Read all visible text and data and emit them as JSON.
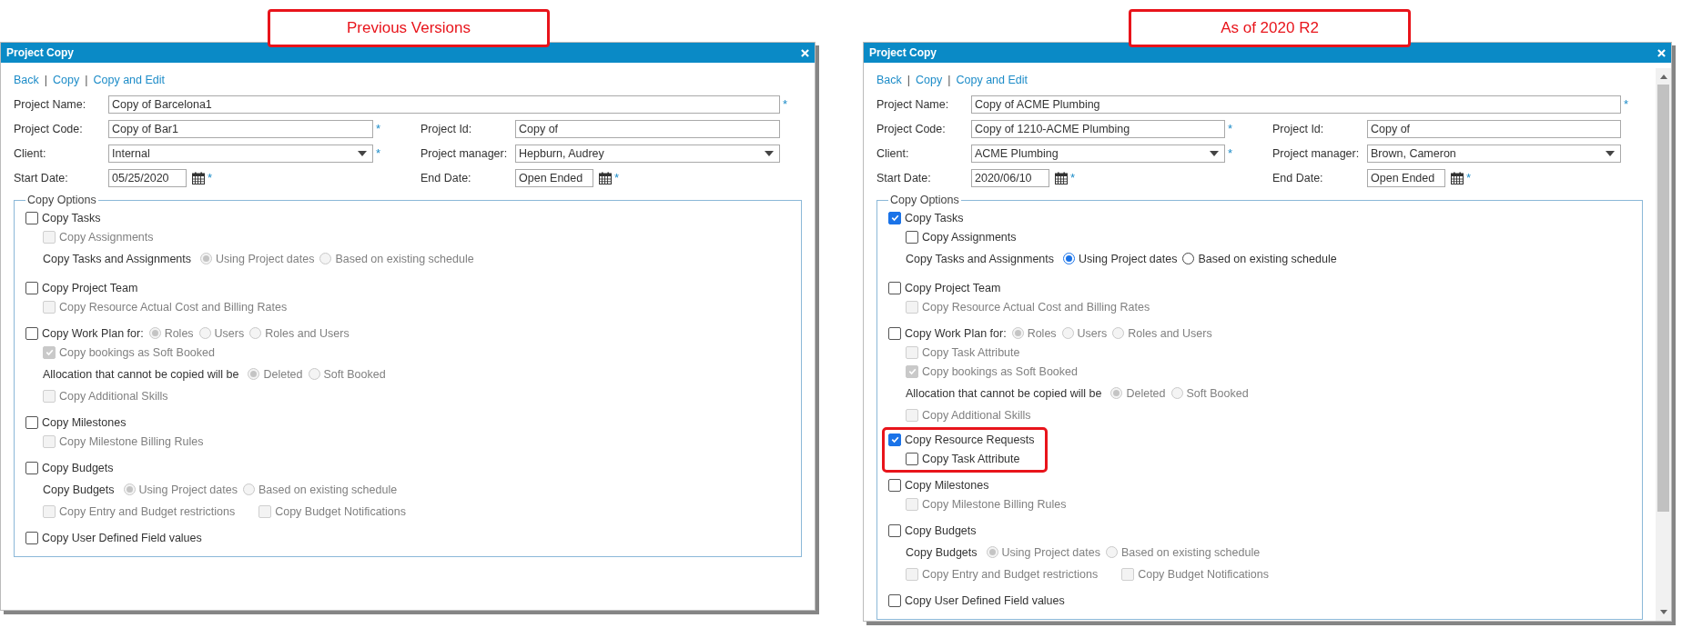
{
  "panels": [
    {
      "caption": "Previous Versions",
      "window_title": "Project Copy",
      "toolbar": [
        {
          "kind": "link",
          "text": "Back"
        },
        {
          "kind": "separator",
          "text": "|"
        },
        {
          "kind": "link",
          "text": "Copy"
        },
        {
          "kind": "separator",
          "text": "|"
        },
        {
          "kind": "link",
          "text": "Copy and Edit"
        }
      ],
      "field_rows": [
        [
          {
            "label": "Project Name:",
            "kind": "text",
            "value": "Copy of Barcelona1",
            "required_mark": "*"
          }
        ],
        [
          {
            "label": "Project Code:",
            "kind": "text",
            "value": "Copy of Bar1",
            "required_mark": "*"
          },
          {
            "label": "Project Id:",
            "kind": "text",
            "value": "Copy of"
          }
        ],
        [
          {
            "label": "Client:",
            "kind": "select",
            "value": "Internal",
            "required_mark": "*"
          },
          {
            "label": "Project manager:",
            "kind": "select",
            "value": "Hepburn, Audrey"
          }
        ],
        [
          {
            "label": "Start Date:",
            "kind": "date",
            "value": "05/25/2020",
            "required_mark": "*"
          },
          {
            "label": "End Date:",
            "kind": "date",
            "value": "Open Ended",
            "required_mark": "*"
          }
        ]
      ],
      "options_title": "Copy Options",
      "options": [
        {
          "label": "Copy Tasks",
          "checked": false,
          "children": [
            {
              "kind": "check",
              "label": "Copy Assignments",
              "checked": false,
              "disabled": true
            },
            {
              "kind": "radios",
              "label": "Copy Tasks and Assignments",
              "disabled": true,
              "options": [
                {
                  "label": "Using Project dates",
                  "selected": true
                },
                {
                  "label": "Based on existing schedule",
                  "selected": false
                }
              ]
            }
          ]
        },
        {
          "label": "Copy Project Team",
          "checked": false,
          "children": [
            {
              "kind": "check",
              "label": "Copy Resource Actual Cost and Billing Rates",
              "checked": false,
              "disabled": true
            }
          ]
        },
        {
          "label": "Copy Work Plan for:",
          "checked": false,
          "radios_disabled": true,
          "radios": [
            {
              "label": "Roles",
              "selected": true
            },
            {
              "label": "Users",
              "selected": false
            },
            {
              "label": "Roles and Users",
              "selected": false
            }
          ],
          "children": [
            {
              "kind": "check",
              "label": "Copy bookings as Soft Booked",
              "checked": true,
              "disabled": true
            },
            {
              "kind": "radios",
              "label": "Allocation that cannot be copied will be",
              "disabled": true,
              "options": [
                {
                  "label": "Deleted",
                  "selected": true
                },
                {
                  "label": "Soft Booked",
                  "selected": false
                }
              ]
            },
            {
              "kind": "check",
              "label": "Copy Additional Skills",
              "checked": false,
              "disabled": true
            }
          ]
        },
        {
          "label": "Copy Milestones",
          "checked": false,
          "children": [
            {
              "kind": "check",
              "label": "Copy Milestone Billing Rules",
              "checked": false,
              "disabled": true
            }
          ]
        },
        {
          "label": "Copy Budgets",
          "checked": false,
          "children": [
            {
              "kind": "radios",
              "label": "Copy Budgets",
              "disabled": true,
              "options": [
                {
                  "label": "Using Project dates",
                  "selected": true
                },
                {
                  "label": "Based on existing schedule",
                  "selected": false
                }
              ]
            },
            {
              "kind": "checks",
              "disabled": true,
              "items": [
                {
                  "label": "Copy Entry and Budget restrictions",
                  "checked": false
                },
                {
                  "label": "Copy Budget Notifications",
                  "checked": false
                }
              ]
            }
          ]
        },
        {
          "label": "Copy User Defined Field values",
          "checked": false
        }
      ]
    },
    {
      "caption": "As of 2020 R2",
      "window_title": "Project Copy",
      "scrollable": true,
      "toolbar": [
        {
          "kind": "link",
          "text": "Back"
        },
        {
          "kind": "separator",
          "text": "|"
        },
        {
          "kind": "link",
          "text": "Copy"
        },
        {
          "kind": "separator",
          "text": "|"
        },
        {
          "kind": "link",
          "text": "Copy and Edit"
        }
      ],
      "field_rows": [
        [
          {
            "label": "Project Name:",
            "kind": "text",
            "value": "Copy of ACME Plumbing",
            "required_mark": "*"
          }
        ],
        [
          {
            "label": "Project Code:",
            "kind": "text",
            "value": "Copy of 1210-ACME Plumbing",
            "required_mark": "*"
          },
          {
            "label": "Project Id:",
            "kind": "text",
            "value": "Copy of"
          }
        ],
        [
          {
            "label": "Client:",
            "kind": "select",
            "value": "ACME Plumbing",
            "required_mark": "*"
          },
          {
            "label": "Project manager:",
            "kind": "select",
            "value": "Brown, Cameron"
          }
        ],
        [
          {
            "label": "Start Date:",
            "kind": "date",
            "value": "2020/06/10",
            "required_mark": "*"
          },
          {
            "label": "End Date:",
            "kind": "date",
            "value": "Open Ended",
            "required_mark": "*"
          }
        ]
      ],
      "options_title": "Copy Options",
      "options": [
        {
          "label": "Copy Tasks",
          "checked": true,
          "children": [
            {
              "kind": "check",
              "label": "Copy Assignments",
              "checked": false,
              "disabled": false
            },
            {
              "kind": "radios",
              "label": "Copy Tasks and Assignments",
              "disabled": false,
              "options": [
                {
                  "label": "Using Project dates",
                  "selected": true
                },
                {
                  "label": "Based on existing schedule",
                  "selected": false
                }
              ]
            }
          ]
        },
        {
          "label": "Copy Project Team",
          "checked": false,
          "children": [
            {
              "kind": "check",
              "label": "Copy Resource Actual Cost and Billing Rates",
              "checked": false,
              "disabled": true
            }
          ]
        },
        {
          "label": "Copy Work Plan for:",
          "checked": false,
          "radios_disabled": true,
          "radios": [
            {
              "label": "Roles",
              "selected": true
            },
            {
              "label": "Users",
              "selected": false
            },
            {
              "label": "Roles and Users",
              "selected": false
            }
          ],
          "children": [
            {
              "kind": "check",
              "label": "Copy Task Attribute",
              "checked": false,
              "disabled": true
            },
            {
              "kind": "check",
              "label": "Copy bookings as Soft Booked",
              "checked": true,
              "disabled": true
            },
            {
              "kind": "radios",
              "label": "Allocation that cannot be copied will be",
              "disabled": true,
              "options": [
                {
                  "label": "Deleted",
                  "selected": true
                },
                {
                  "label": "Soft Booked",
                  "selected": false
                }
              ]
            },
            {
              "kind": "check",
              "label": "Copy Additional Skills",
              "checked": false,
              "disabled": true
            }
          ]
        },
        {
          "label": "Copy Resource Requests",
          "checked": true,
          "highlighted": true,
          "children": [
            {
              "kind": "check",
              "label": "Copy Task Attribute",
              "checked": false,
              "disabled": false
            }
          ]
        },
        {
          "label": "Copy Milestones",
          "checked": false,
          "children": [
            {
              "kind": "check",
              "label": "Copy Milestone Billing Rules",
              "checked": false,
              "disabled": true
            }
          ]
        },
        {
          "label": "Copy Budgets",
          "checked": false,
          "children": [
            {
              "kind": "radios",
              "label": "Copy Budgets",
              "disabled": true,
              "options": [
                {
                  "label": "Using Project dates",
                  "selected": true
                },
                {
                  "label": "Based on existing schedule",
                  "selected": false
                }
              ]
            },
            {
              "kind": "checks",
              "disabled": true,
              "items": [
                {
                  "label": "Copy Entry and Budget restrictions",
                  "checked": false
                },
                {
                  "label": "Copy Budget Notifications",
                  "checked": false
                }
              ]
            }
          ]
        },
        {
          "label": "Copy User Defined Field values",
          "checked": false
        }
      ]
    }
  ]
}
